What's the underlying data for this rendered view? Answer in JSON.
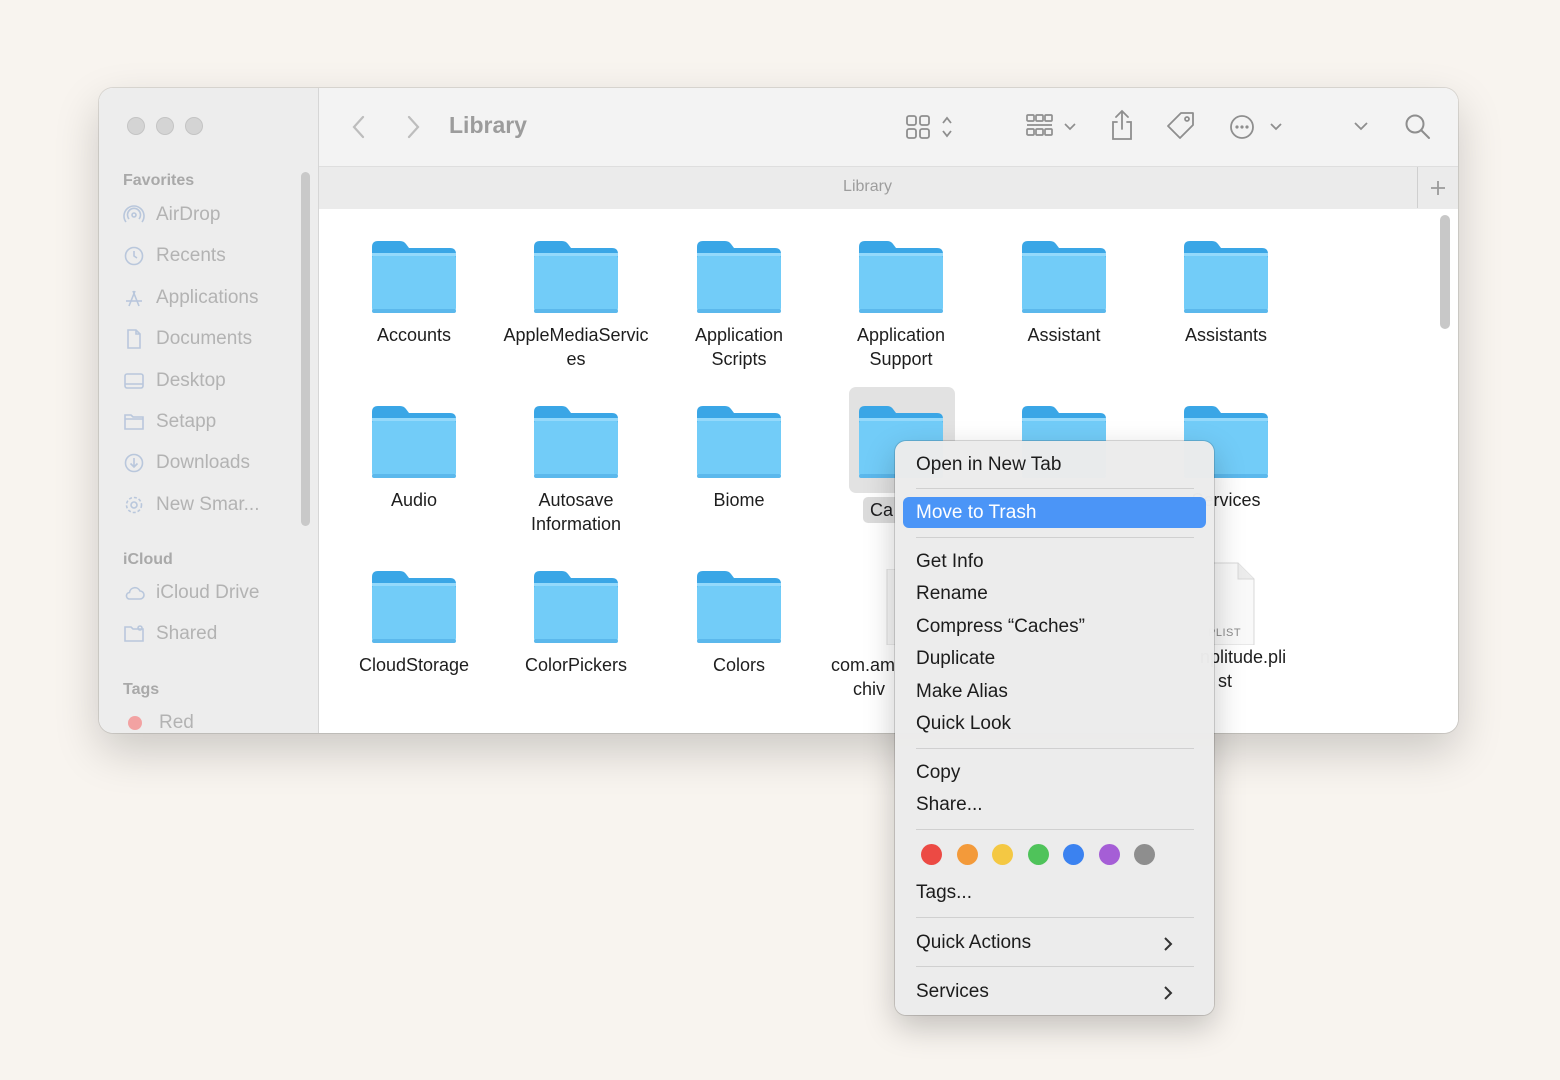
{
  "window": {
    "title": "Library",
    "path_label": "Library"
  },
  "sidebar": {
    "favorites_label": "Favorites",
    "favorites": [
      {
        "label": "AirDrop",
        "icon": "airdrop-icon"
      },
      {
        "label": "Recents",
        "icon": "clock-icon"
      },
      {
        "label": "Applications",
        "icon": "applications-icon"
      },
      {
        "label": "Documents",
        "icon": "document-icon"
      },
      {
        "label": "Desktop",
        "icon": "desktop-icon"
      },
      {
        "label": "Setapp",
        "icon": "folder-icon"
      },
      {
        "label": "Downloads",
        "icon": "download-icon"
      },
      {
        "label": "New Smar...",
        "icon": "gear-icon"
      }
    ],
    "icloud_label": "iCloud",
    "icloud": [
      {
        "label": "iCloud Drive",
        "icon": "cloud-icon"
      },
      {
        "label": "Shared",
        "icon": "shared-folder-icon"
      }
    ],
    "tags_label": "Tags",
    "tags": [
      {
        "label": "Red",
        "color": "#f2a2a2"
      }
    ]
  },
  "files": {
    "row1": [
      "Accounts",
      "AppleMediaServic",
      "Application",
      "Application",
      "Assistant",
      "Assistants"
    ],
    "row1_line2": [
      "",
      "es",
      "Scripts",
      "Support",
      "",
      ""
    ],
    "row2": [
      "Audio",
      "Autosave",
      "Biome",
      "Ca",
      "",
      "Services"
    ],
    "row2_line2": [
      "",
      "Information",
      "",
      "",
      "",
      ""
    ],
    "row3": [
      "CloudStorage",
      "ColorPickers",
      "Colors",
      "com.am",
      "",
      "nplitude.pli"
    ],
    "row3_line2": [
      "",
      "",
      "",
      "chiv",
      "",
      "st"
    ],
    "plist_badge": "PLIST",
    "selected": "Caches"
  },
  "context_menu": {
    "open_new_tab": "Open in New Tab",
    "move_to_trash": "Move to Trash",
    "get_info": "Get Info",
    "rename": "Rename",
    "compress": "Compress “Caches”",
    "duplicate": "Duplicate",
    "make_alias": "Make Alias",
    "quick_look": "Quick Look",
    "copy": "Copy",
    "share": "Share...",
    "tag_colors": [
      "#ec4a44",
      "#f39a3a",
      "#f4c843",
      "#4fc35a",
      "#3b82f0",
      "#a55ed6",
      "#8e8e8e"
    ],
    "tags": "Tags...",
    "quick_actions": "Quick Actions",
    "services": "Services"
  }
}
